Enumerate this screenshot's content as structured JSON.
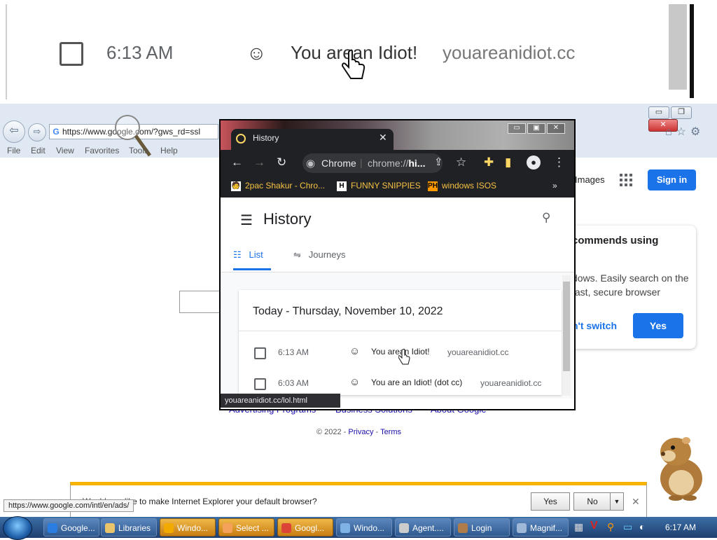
{
  "magnifier": {
    "time": "6:13 AM",
    "face": "☺",
    "title": "You arean Idiot!",
    "domain": "youareanidiot.cc"
  },
  "ie": {
    "address": "https://www.google.com/?gws_rd=ssl",
    "menu": [
      "File",
      "Edit",
      "View",
      "Favorites",
      "Tools",
      "Help"
    ],
    "controls": {
      "minimize": "▭",
      "restore": "❐",
      "close": "✕"
    },
    "notify_text": "Would you like to make Internet Explorer your default browser?",
    "notify_yes": "Yes",
    "notify_no": "No",
    "status_tip": "https://www.google.com/intl/en/ads/"
  },
  "google": {
    "images_link": "Images",
    "signin_button": "Sign in",
    "card_title": "commends using",
    "card_text": "dows. Easily search on the fast, secure browser",
    "dont_switch": "n't switch",
    "yes_button": "Yes",
    "footer_links": [
      "Advertising Programs",
      "Business Solutions",
      "About Google"
    ],
    "copyright": "© 2022 -",
    "privacy": "Privacy",
    "terms": "Terms"
  },
  "chrome": {
    "tab_title": "History",
    "omnibox_label": "Chrome",
    "omnibox_url_prefix": "chrome://",
    "omnibox_url_bold": "hi...",
    "bookmarks": [
      {
        "label": "2pac Shakur - Chro...",
        "icon": "🧑"
      },
      {
        "label": "FUNNY SNIPPIES",
        "icon": "H"
      },
      {
        "label": "windows ISOS",
        "icon": "PH"
      }
    ],
    "bookmarks_more": "»",
    "page_title": "History",
    "tabs": {
      "list": "List",
      "journeys": "Journeys"
    },
    "date_header": "Today - Thursday, November 10, 2022",
    "entries": [
      {
        "time": "6:13 AM",
        "face": "☺",
        "title": "You arean Idiot!",
        "domain": "youareanidiot.cc"
      },
      {
        "time": "6:03 AM",
        "face": "☺",
        "title": "You are an Idiot! (dot cc)",
        "domain": "youareanidiot.cc"
      }
    ],
    "status_url": "youareanidiot.cc/lol.html"
  },
  "taskbar": {
    "items": [
      {
        "label": "Google...",
        "icon_color": "#2a7de1",
        "highlight": false
      },
      {
        "label": "Libraries",
        "icon_color": "#e9c46a",
        "highlight": false
      },
      {
        "label": "Windo...",
        "icon_color": "#f2a900",
        "highlight": true
      },
      {
        "label": "Select ...",
        "icon_color": "#f4a259",
        "highlight": true
      },
      {
        "label": "Googl...",
        "icon_color": "#db4437",
        "highlight": true
      },
      {
        "label": "Windo...",
        "icon_color": "#7fb3e6",
        "highlight": false
      },
      {
        "label": "Agent....",
        "icon_color": "#cccccc",
        "highlight": false
      },
      {
        "label": "Login",
        "icon_color": "#b07d4a",
        "highlight": false
      },
      {
        "label": "Magnif...",
        "icon_color": "#9fb8d8",
        "highlight": false
      }
    ],
    "clock": "6:17 AM"
  }
}
